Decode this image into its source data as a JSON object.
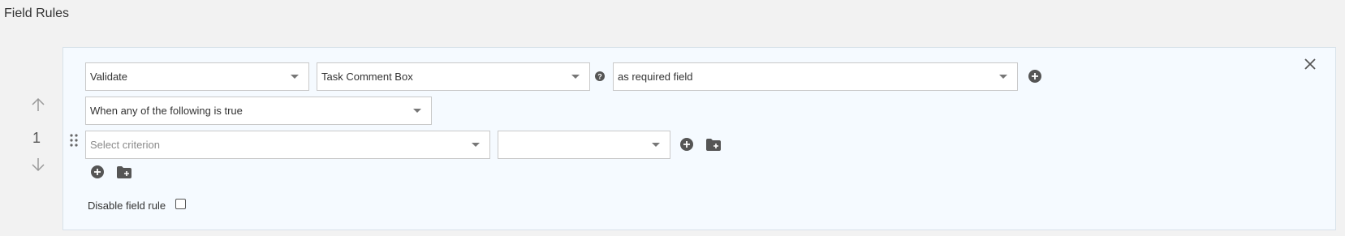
{
  "page": {
    "title": "Field Rules"
  },
  "rule": {
    "order_number": "1",
    "action_select": "Validate",
    "field_select": "Task Comment Box",
    "validation_select": "as required field",
    "condition_select": "When any of the following is true",
    "criterion_placeholder": "Select criterion",
    "operator_select": "",
    "disable_label": "Disable field rule",
    "disabled": false
  },
  "icons": {
    "close": "close-icon",
    "up": "arrow-up-icon",
    "down": "arrow-down-icon",
    "drag": "drag-handle-icon",
    "help": "help-icon",
    "add": "plus-circle-icon",
    "add_group": "folder-plus-icon"
  },
  "colors": {
    "card_background": "#f5faff",
    "icon_dark": "#555555"
  }
}
